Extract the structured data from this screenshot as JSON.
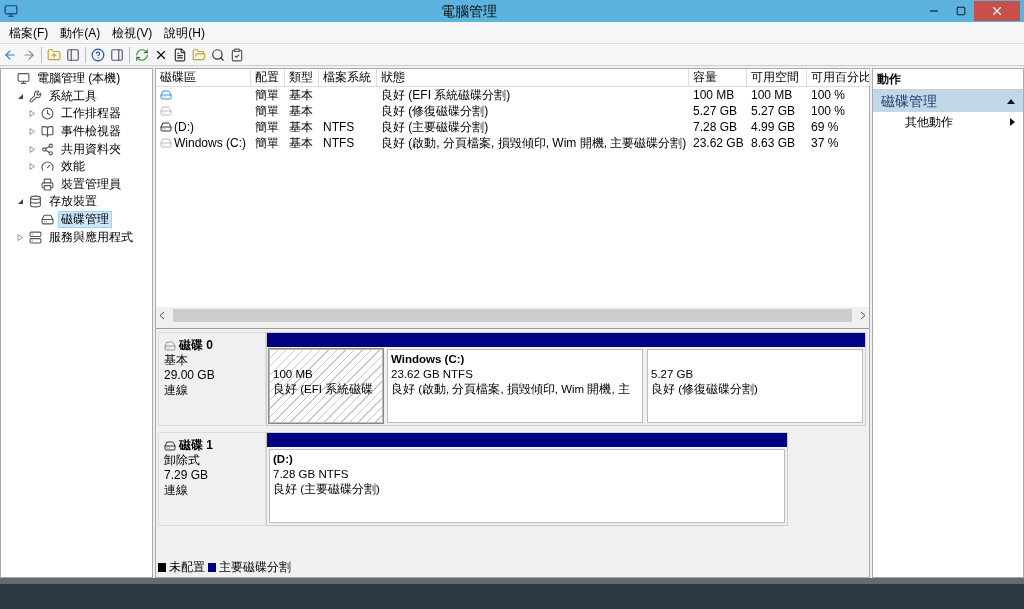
{
  "window": {
    "title": "電腦管理"
  },
  "menu": [
    "檔案(F)",
    "動作(A)",
    "檢視(V)",
    "說明(H)"
  ],
  "tree": [
    {
      "label": "電腦管理 (本機)",
      "kind": "computer",
      "selected": false,
      "children": [
        {
          "label": "系統工具",
          "kind": "tools",
          "selected": false,
          "expanded": true,
          "children": [
            {
              "label": "工作排程器",
              "kind": "clock",
              "selected": false,
              "expanded": false
            },
            {
              "label": "事件檢視器",
              "kind": "event",
              "selected": false,
              "expanded": false
            },
            {
              "label": "共用資料夾",
              "kind": "share",
              "selected": false,
              "expanded": false
            },
            {
              "label": "效能",
              "kind": "performance",
              "selected": false,
              "expanded": false
            },
            {
              "label": "裝置管理員",
              "kind": "device",
              "selected": false
            }
          ]
        },
        {
          "label": "存放裝置",
          "kind": "storage",
          "selected": false,
          "expanded": true,
          "children": [
            {
              "label": "磁碟管理",
              "kind": "disk",
              "selected": true
            }
          ]
        },
        {
          "label": "服務與應用程式",
          "kind": "services",
          "selected": false,
          "expanded": false
        }
      ]
    }
  ],
  "table": {
    "columns": [
      "磁碟區",
      "配置",
      "類型",
      "檔案系統",
      "狀態",
      "容量",
      "可用空間",
      "可用百分比"
    ],
    "rows": [
      {
        "kind": "efi",
        "cells": [
          null,
          "簡單",
          "基本",
          null,
          "良好 (EFI 系統磁碟分割)",
          "100 MB",
          "100 MB",
          "100 %"
        ]
      },
      {
        "kind": "recovery",
        "cells": [
          null,
          "簡單",
          "基本",
          null,
          "良好 (修復磁碟分割)",
          "5.27 GB",
          "5.27 GB",
          "100 %"
        ]
      },
      {
        "kind": "removable",
        "cells": [
          "(D:)",
          "簡單",
          "基本",
          "NTFS",
          "良好 (主要磁碟分割)",
          "7.28 GB",
          "4.99 GB",
          "69 %"
        ]
      },
      {
        "kind": "recovery",
        "cells": [
          "Windows (C:)",
          "簡單",
          "基本",
          "NTFS",
          "良好 (啟動, 分頁檔案, 損毀傾印, Wim 開機, 主要磁碟分割)",
          "23.62 GB",
          "8.63 GB",
          "37 %"
        ]
      }
    ]
  },
  "disks": [
    {
      "name": "磁碟 0",
      "kind": "fixed",
      "type": "基本",
      "size": "29.00 GB",
      "status": "連線",
      "partitions": [
        {
          "selected": true,
          "size": "100 MB",
          "status": "良好 (EFI 系統磁碟"
        },
        {
          "selected": false,
          "name": "Windows  (C:)",
          "size": "23.62 GB NTFS",
          "status": "良好 (啟動, 分頁檔案, 損毀傾印, Wim 開機, 主"
        },
        {
          "selected": false,
          "size": "5.27 GB",
          "status": "良好 (修復磁碟分割)"
        }
      ]
    },
    {
      "name": "磁碟 1",
      "kind": "removable",
      "type": "卸除式",
      "size": "7.29 GB",
      "status": "連線",
      "partitions": [
        {
          "selected": false,
          "name": "(D:)",
          "size": "7.28 GB NTFS",
          "status": "良好 (主要磁碟分割)"
        }
      ]
    }
  ],
  "legend": [
    {
      "label": "未配置",
      "color": "#000000"
    },
    {
      "label": "主要磁碟分割",
      "color": "#000080"
    }
  ],
  "actions": {
    "header": "動作",
    "section": {
      "title": "磁碟管理",
      "expanded": true,
      "items": [
        "其他動作"
      ]
    }
  }
}
